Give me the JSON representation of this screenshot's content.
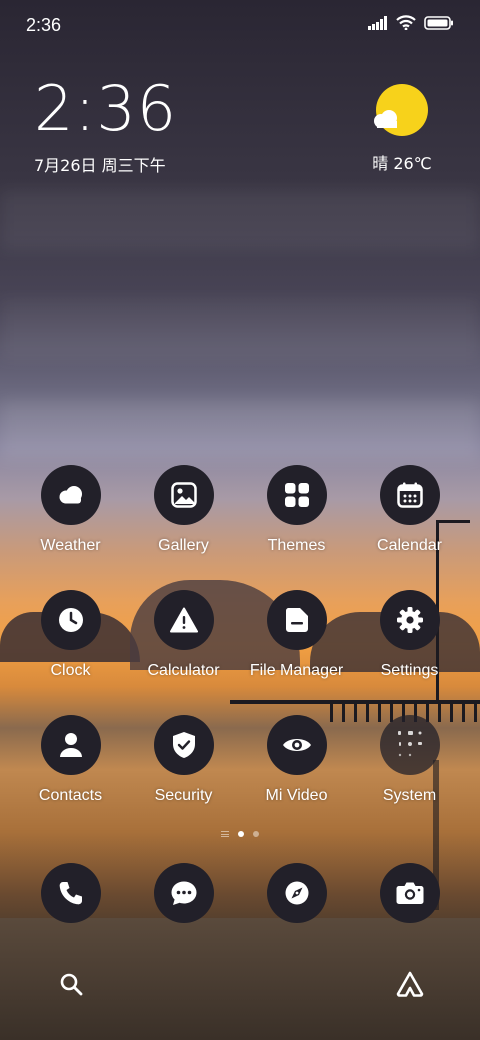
{
  "status": {
    "time": "2:36",
    "icons": [
      "signal-icon",
      "wifi-icon",
      "battery-icon"
    ]
  },
  "clock_widget": {
    "time": "2:36",
    "date": "7月26日 周三下午"
  },
  "weather_widget": {
    "condition_temp": "晴 26℃",
    "icon": "sunny-partly-cloudy-icon",
    "sun_color": "#f7d21b"
  },
  "apps": [
    {
      "label": "Weather",
      "icon": "weather-icon"
    },
    {
      "label": "Gallery",
      "icon": "gallery-icon"
    },
    {
      "label": "Themes",
      "icon": "themes-icon"
    },
    {
      "label": "Calendar",
      "icon": "calendar-icon"
    },
    {
      "label": "Clock",
      "icon": "clock-icon"
    },
    {
      "label": "Calculator",
      "icon": "calculator-icon"
    },
    {
      "label": "File Manager",
      "icon": "file-manager-icon"
    },
    {
      "label": "Settings",
      "icon": "settings-icon"
    },
    {
      "label": "Contacts",
      "icon": "contacts-icon"
    },
    {
      "label": "Security",
      "icon": "security-icon"
    },
    {
      "label": "Mi Video",
      "icon": "mi-video-icon"
    },
    {
      "label": "System",
      "icon": "system-folder-icon"
    }
  ],
  "page_indicator": {
    "pages": 2,
    "current": 1
  },
  "dock": [
    {
      "icon": "phone-icon"
    },
    {
      "icon": "messages-icon"
    },
    {
      "icon": "browser-icon"
    },
    {
      "icon": "camera-icon"
    }
  ],
  "bottom_bar": {
    "left_icon": "search-icon",
    "right_icon": "app-vault-icon"
  },
  "colors": {
    "icon_bg": "#222029",
    "icon_fg": "#ffffff"
  }
}
